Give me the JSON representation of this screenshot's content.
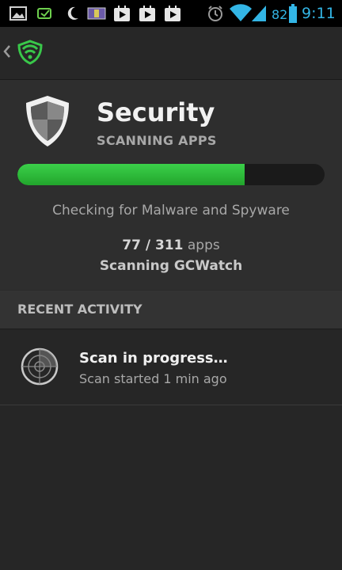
{
  "status_bar": {
    "battery_level": "82",
    "time": "9:11",
    "icons": [
      "gallery-icon",
      "sync-icon",
      "moon-icon",
      "media-icon",
      "play-store-icon",
      "play-store-icon",
      "play-store-icon",
      "alarm-icon",
      "wifi-icon",
      "signal-icon",
      "battery-icon"
    ]
  },
  "action_bar": {
    "icons": [
      "back-chevron-icon",
      "app-logo-icon"
    ]
  },
  "header": {
    "title": "Security",
    "subtitle": "SCANNING APPS",
    "progress_fraction": 0.74,
    "status_text": "Checking for Malware and Spyware",
    "scanned_count": "77 / 311",
    "count_unit": "apps",
    "scanning_label": "Scanning GCWatch",
    "accent_color": "#2fbf3b"
  },
  "recent_activity": {
    "section_title": "RECENT ACTIVITY",
    "items": [
      {
        "title": "Scan in progress…",
        "subtitle": "Scan started 1 min ago",
        "icon": "radar-icon"
      }
    ]
  }
}
